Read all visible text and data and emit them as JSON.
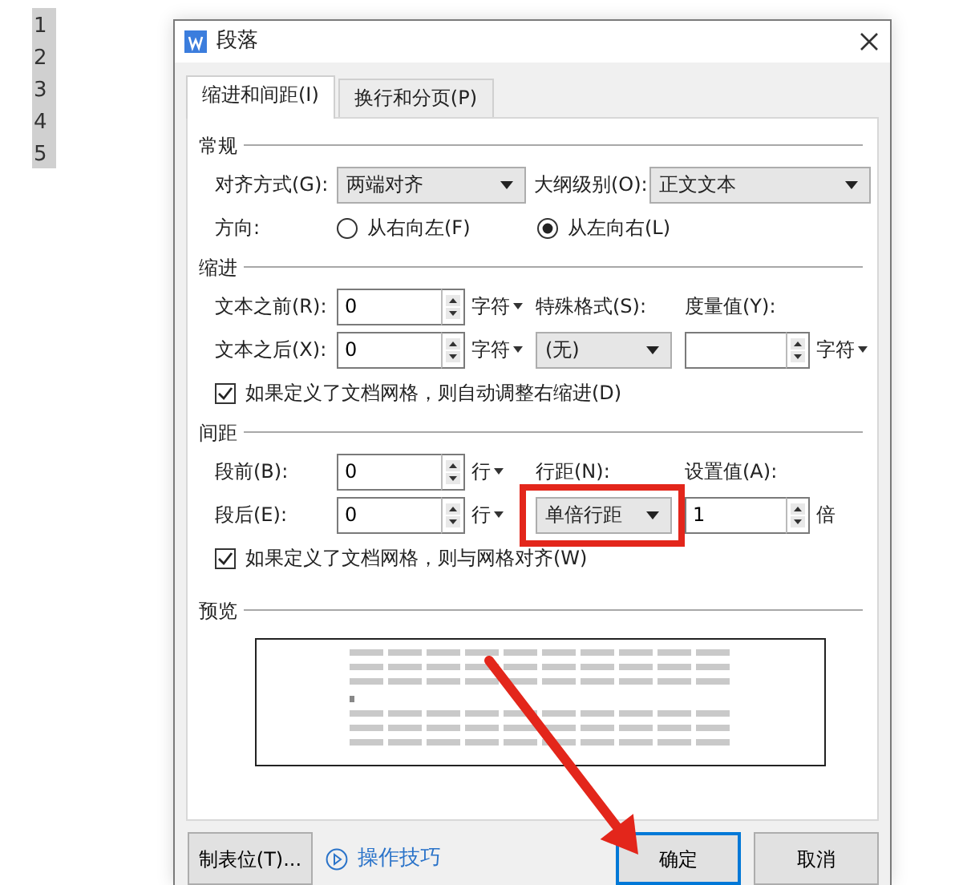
{
  "line_numbers": [
    "1",
    "2",
    "3",
    "4",
    "5"
  ],
  "dialog": {
    "title": "段落",
    "tabs": [
      {
        "label": "缩进和间距(I)",
        "selected": true
      },
      {
        "label": "换行和分页(P)",
        "selected": false
      }
    ],
    "general": {
      "title": "常规",
      "alignment": {
        "label": "对齐方式(G):",
        "value": "两端对齐"
      },
      "outline_level": {
        "label": "大纲级别(O):",
        "value": "正文文本"
      },
      "direction": {
        "label": "方向:",
        "options": [
          {
            "label": "从右向左(F)",
            "selected": false
          },
          {
            "label": "从左向右(L)",
            "selected": true
          }
        ]
      }
    },
    "indent": {
      "title": "缩进",
      "before": {
        "label": "文本之前(R):",
        "value": "0",
        "unit": "字符"
      },
      "after": {
        "label": "文本之后(X):",
        "value": "0",
        "unit": "字符"
      },
      "special": {
        "label": "特殊格式(S):",
        "value": "(无)"
      },
      "measure": {
        "label": "度量值(Y):",
        "unit": "字符"
      },
      "auto_adjust": {
        "label": "如果定义了文档网格，则自动调整右缩进(D)",
        "checked": true
      }
    },
    "spacing": {
      "title": "间距",
      "before": {
        "label": "段前(B):",
        "value": "0",
        "unit": "行"
      },
      "after": {
        "label": "段后(E):",
        "value": "0",
        "unit": "行"
      },
      "line_spacing": {
        "label": "行距(N):",
        "value": "单倍行距",
        "highlighted": true
      },
      "setting": {
        "label": "设置值(A):",
        "value": "1",
        "unit": "倍"
      },
      "snap_to_grid": {
        "label": "如果定义了文档网格，则与网格对齐(W)",
        "checked": true
      }
    },
    "preview": {
      "title": "预览"
    },
    "buttons": [
      {
        "label": "制表位(T)...",
        "kind": "button",
        "default": false,
        "pointed_at": false
      },
      {
        "label": "操作技巧",
        "kind": "link"
      },
      {
        "label": "确定",
        "kind": "button",
        "default": true,
        "pointed_at": true
      },
      {
        "label": "取消",
        "kind": "button",
        "default": false,
        "pointed_at": false
      }
    ]
  }
}
